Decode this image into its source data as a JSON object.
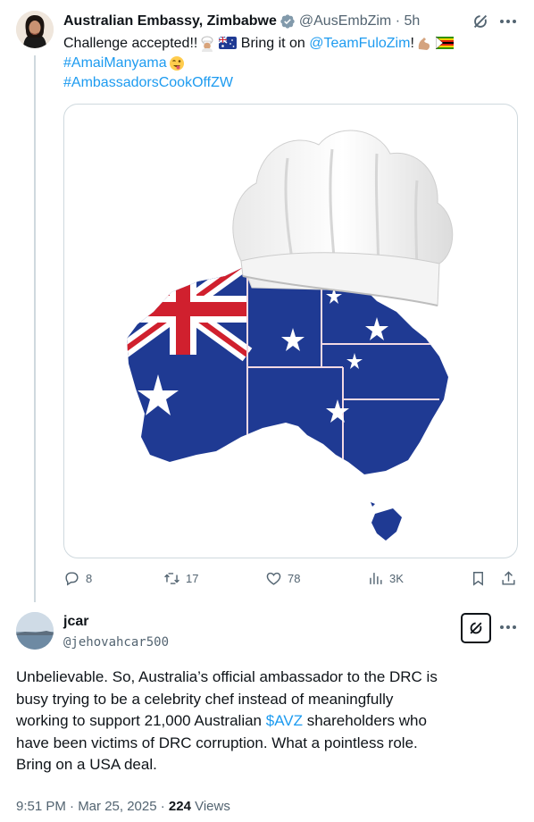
{
  "tweet": {
    "author_name": "Australian Embassy, Zimbabwe",
    "handle": "@AusEmbZim",
    "time": "· 5h",
    "lines": {
      "l1_a": "Challenge accepted!!",
      "l1_b": "Bring it on",
      "l1_mention": "@TeamFuloZim",
      "l1_c": "!",
      "l2_tag": "#AmaiManyama",
      "l3_tag": "#AmbassadorsCookOffZW"
    },
    "media_alt": "Map of Australia in flag colours wearing a white chef's hat",
    "actions": {
      "replies": "8",
      "reposts": "17",
      "likes": "78",
      "views": "3K"
    }
  },
  "reply": {
    "author_name": "jcar",
    "handle": "@jehovahcar500",
    "body": {
      "line1": "Unbelievable. So, Australia’s official ambassador to the DRC is",
      "line2": "busy trying to be a celebrity chef instead of meaningfully",
      "line3a": "working to support 21,000 Australian ",
      "line3_cashtag": "$AVZ",
      "line3b": " shareholders who",
      "line4": "have been victims of DRC corruption. What a pointless role.",
      "line5": "Bring on a USA deal."
    },
    "meta": {
      "time": "9:51 PM · Mar 25, 2025 · ",
      "views_count": "224",
      "views_label": " Views"
    }
  },
  "colors": {
    "link": "#1d9bf0",
    "secondary_text": "#536471",
    "primary_text": "#0f1419",
    "verified": "#829aab",
    "flag_blue": "#1f3a93",
    "flag_red": "#d0202e"
  },
  "icons": [
    "verified-badge-icon",
    "grok-icon",
    "more-icon",
    "reply-icon",
    "repost-icon",
    "like-icon",
    "views-icon",
    "bookmark-icon",
    "share-icon"
  ]
}
